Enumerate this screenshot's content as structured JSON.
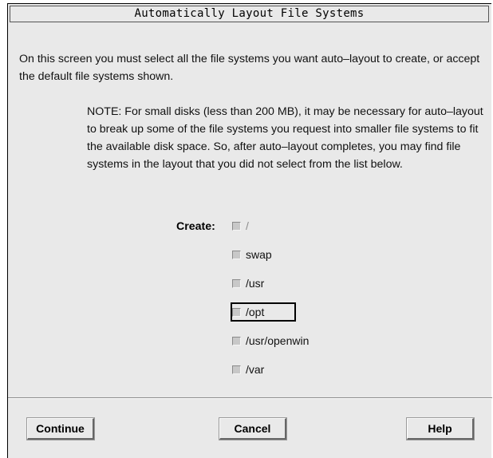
{
  "window": {
    "title": "Automatically Layout File Systems"
  },
  "intro": "On this screen you must select all the file systems you want auto–layout to create, or accept the default file systems shown.",
  "note": "NOTE: For small disks (less than 200 MB), it may be necessary for auto–layout to break up some of the file systems you request into smaller file systems to fit the available disk space. So, after auto–layout completes, you may find file systems in the layout that you did not select from the list below.",
  "create": {
    "label": "Create:",
    "options": [
      {
        "label": "/",
        "checked": true,
        "enabled": false
      },
      {
        "label": "swap",
        "checked": true,
        "enabled": true
      },
      {
        "label": "/usr",
        "checked": true,
        "enabled": true
      },
      {
        "label": "/opt",
        "checked": true,
        "enabled": true,
        "focused": true
      },
      {
        "label": "/usr/openwin",
        "checked": false,
        "enabled": true
      },
      {
        "label": "/var",
        "checked": false,
        "enabled": true
      }
    ]
  },
  "buttons": {
    "continue": "Continue",
    "cancel": "Cancel",
    "help": "Help"
  }
}
